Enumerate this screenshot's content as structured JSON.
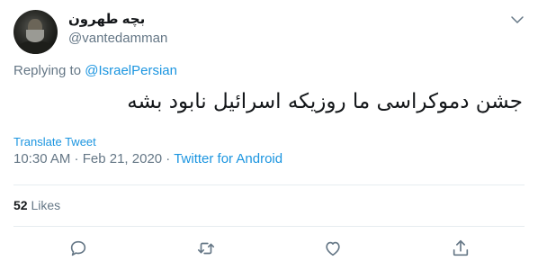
{
  "author": {
    "display_name": "بچه طهرون",
    "handle": "@vantedamman"
  },
  "reply": {
    "prefix": "Replying to ",
    "to_handle": "@IsraelPersian"
  },
  "tweet": {
    "text": "جشن دموکراسی ما روزیکه اسرائیل نابود بشه",
    "translate_label": "Translate Tweet",
    "time": "10:30 AM",
    "separator1": " · ",
    "date": "Feb 21, 2020",
    "separator2": " · ",
    "source": "Twitter for Android"
  },
  "stats": {
    "likes_count": "52",
    "likes_label": "Likes"
  },
  "actions": {
    "reply_icon": "reply-icon",
    "retweet_icon": "retweet-icon",
    "like_icon": "heart-icon",
    "share_icon": "share-icon"
  },
  "colors": {
    "link": "#1b95e0",
    "muted": "#657786",
    "text": "#14171a",
    "divider": "#e6ecf0"
  }
}
